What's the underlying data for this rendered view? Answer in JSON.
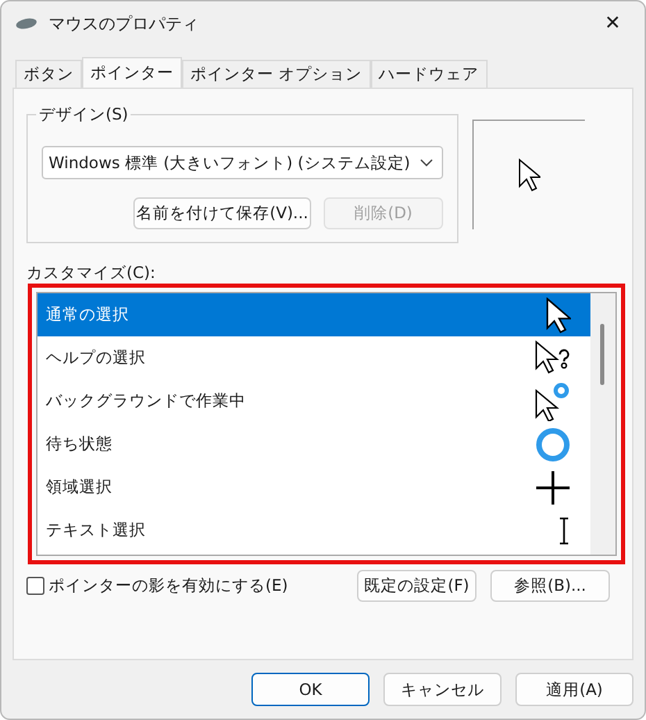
{
  "window": {
    "title": "マウスのプロパティ",
    "close": "✕"
  },
  "tabs": [
    {
      "label": "ボタン",
      "selected": false
    },
    {
      "label": "ポインター",
      "selected": true
    },
    {
      "label": "ポインター オプション",
      "selected": false
    },
    {
      "label": "ハードウェア",
      "selected": false
    }
  ],
  "design": {
    "label": "デザイン(S)",
    "value": "Windows 標準 (大きいフォント) (システム設定)",
    "save_button": "名前を付けて保存(V)...",
    "delete_button": {
      "label": "削除(D)",
      "disabled": true
    }
  },
  "customize": {
    "label": "カスタマイズ(C):",
    "highlighted": true,
    "items": [
      {
        "label": "通常の選択",
        "kind": "arrow",
        "selected": true
      },
      {
        "label": "ヘルプの選択",
        "kind": "help",
        "selected": false
      },
      {
        "label": "バックグラウンドで作業中",
        "kind": "working",
        "selected": false
      },
      {
        "label": "待ち状態",
        "kind": "busy",
        "selected": false
      },
      {
        "label": "領域選択",
        "kind": "cross",
        "selected": false
      },
      {
        "label": "テキスト選択",
        "kind": "text",
        "selected": false
      }
    ]
  },
  "shadow": {
    "label": "ポインターの影を有効にする(E)",
    "checked": false
  },
  "default_button": "既定の設定(F)",
  "browse_button": "参照(B)...",
  "buttons": [
    {
      "label": "OK",
      "default": true
    },
    {
      "label": "キャンセル",
      "default": false
    },
    {
      "label": "適用(A)",
      "default": false
    }
  ]
}
